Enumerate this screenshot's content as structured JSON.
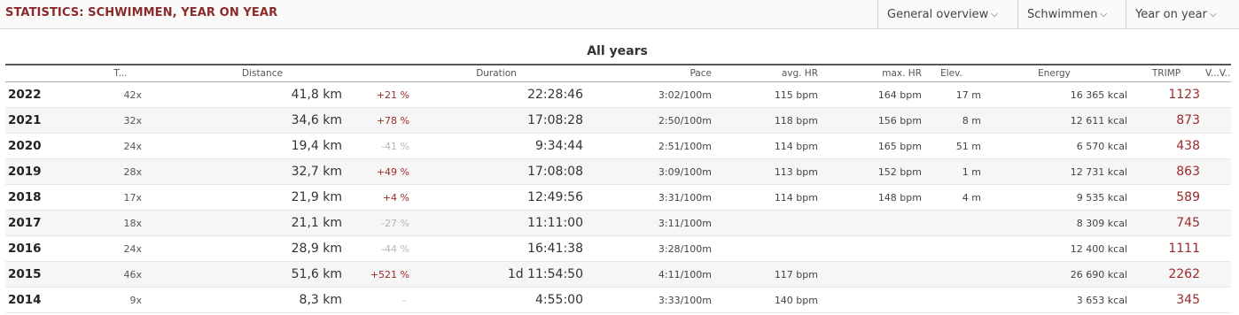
{
  "header": {
    "title": "STATISTICS: SCHWIMMEN, YEAR ON YEAR",
    "menus": [
      {
        "label": "General overview",
        "icon": "chevron-down-icon"
      },
      {
        "label": "Schwimmen",
        "icon": "chevron-down-icon"
      },
      {
        "label": "Year on year",
        "icon": "chevron-down-icon"
      }
    ]
  },
  "table": {
    "title": "All years",
    "columns": [
      "T...",
      "Distance",
      "Duration",
      "Pace",
      "avg. HR",
      "max. HR",
      "Elev.",
      "Energy",
      "TRIMP",
      "V...V..."
    ],
    "rows": [
      {
        "year": "2022",
        "count": "42x",
        "distance": "41,8 km",
        "change": "+21 %",
        "duration": "22:28:46",
        "pace": "3:02/100m",
        "avg_hr": "115 bpm",
        "max_hr": "164 bpm",
        "elev": "17 m",
        "energy": "16 365 kcal",
        "trimp": "1123"
      },
      {
        "year": "2021",
        "count": "32x",
        "distance": "34,6 km",
        "change": "+78 %",
        "duration": "17:08:28",
        "pace": "2:50/100m",
        "avg_hr": "118 bpm",
        "max_hr": "156 bpm",
        "elev": "8 m",
        "energy": "12 611 kcal",
        "trimp": "873"
      },
      {
        "year": "2020",
        "count": "24x",
        "distance": "19,4 km",
        "change": "-41 %",
        "duration": "9:34:44",
        "pace": "2:51/100m",
        "avg_hr": "114 bpm",
        "max_hr": "165 bpm",
        "elev": "51 m",
        "energy": "6 570 kcal",
        "trimp": "438"
      },
      {
        "year": "2019",
        "count": "28x",
        "distance": "32,7 km",
        "change": "+49 %",
        "duration": "17:08:08",
        "pace": "3:09/100m",
        "avg_hr": "113 bpm",
        "max_hr": "152 bpm",
        "elev": "1 m",
        "energy": "12 731 kcal",
        "trimp": "863"
      },
      {
        "year": "2018",
        "count": "17x",
        "distance": "21,9 km",
        "change": "+4 %",
        "duration": "12:49:56",
        "pace": "3:31/100m",
        "avg_hr": "114 bpm",
        "max_hr": "148 bpm",
        "elev": "4 m",
        "energy": "9 535 kcal",
        "trimp": "589"
      },
      {
        "year": "2017",
        "count": "18x",
        "distance": "21,1 km",
        "change": "-27 %",
        "duration": "11:11:00",
        "pace": "3:11/100m",
        "avg_hr": "",
        "max_hr": "",
        "elev": "",
        "energy": "8 309 kcal",
        "trimp": "745"
      },
      {
        "year": "2016",
        "count": "24x",
        "distance": "28,9 km",
        "change": "-44 %",
        "duration": "16:41:38",
        "pace": "3:28/100m",
        "avg_hr": "",
        "max_hr": "",
        "elev": "",
        "energy": "12 400 kcal",
        "trimp": "1111"
      },
      {
        "year": "2015",
        "count": "46x",
        "distance": "51,6 km",
        "change": "+521 %",
        "duration": "1d 11:54:50",
        "pace": "4:11/100m",
        "avg_hr": "117 bpm",
        "max_hr": "",
        "elev": "",
        "energy": "26 690 kcal",
        "trimp": "2262"
      },
      {
        "year": "2014",
        "count": "9x",
        "distance": "8,3 km",
        "change": "-",
        "duration": "4:55:00",
        "pace": "3:33/100m",
        "avg_hr": "140 bpm",
        "max_hr": "",
        "elev": "",
        "energy": "3 653 kcal",
        "trimp": "345"
      }
    ]
  },
  "colors": {
    "accent": "#8a2a2a",
    "positive_change": "#9b2a2a",
    "negative_change": "#b5b5b5"
  }
}
